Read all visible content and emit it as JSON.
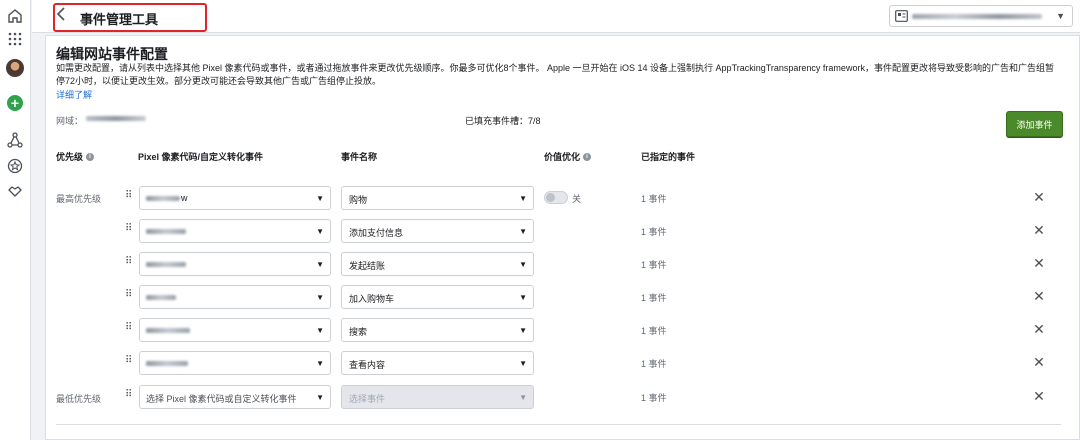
{
  "topbar": {
    "title": "事件管理工具"
  },
  "page": {
    "title": "编辑网站事件配置",
    "description": "如需更改配置，请从列表中选择其他 Pixel 像素代码或事件，或者通过拖放事件来更改优先级顺序。你最多可优化8个事件。 Apple 一旦开始在 iOS 14 设备上强制执行 AppTrackingTransparency framework，事件配置更改将导致受影响的广告和广告组暂停72小时，以便让更改生效。部分更改可能还会导致其他广告或广告组停止投放。",
    "learn_more": "详细了解",
    "domain_label": "网域：",
    "slots_label": "已填充事件槽：7/8",
    "add_event_button": "添加事件"
  },
  "table": {
    "headers": {
      "priority": "优先级",
      "pixel": "Pixel 像素代码/自定义转化事件",
      "event_name": "事件名称",
      "value_opt": "价值优化",
      "assigned": "已指定的事件"
    },
    "highest_priority": "最高优先级",
    "lowest_priority": "最低优先级",
    "toggle_off_label": "关",
    "rows": [
      {
        "pixel_value": "w",
        "event": "购物",
        "assigned": "1 事件"
      },
      {
        "pixel_value": "",
        "event": "添加支付信息",
        "assigned": "1 事件"
      },
      {
        "pixel_value": "",
        "event": "发起结账",
        "assigned": "1 事件"
      },
      {
        "pixel_value": "",
        "event": "加入购物车",
        "assigned": "1 事件"
      },
      {
        "pixel_value": "",
        "event": "搜索",
        "assigned": "1 事件"
      },
      {
        "pixel_value": "",
        "event": "查看内容",
        "assigned": "1 事件"
      },
      {
        "pixel_placeholder": "选择 Pixel 像素代码或自定义转化事件",
        "event_placeholder": "选择事件",
        "assigned": "1 事件"
      }
    ]
  },
  "icons": {
    "rail": [
      "home-icon",
      "apps-grid-icon",
      "avatar",
      "create-plus-icon",
      "network-icon",
      "star-circle-icon",
      "handshake-icon"
    ],
    "handle": "drag-handle-icon",
    "remove": "close-icon",
    "caret": "caret-down-icon"
  },
  "colors": {
    "highlight_border": "#e0242a",
    "add_button": "#4b8a2a",
    "link": "#216fdb"
  }
}
